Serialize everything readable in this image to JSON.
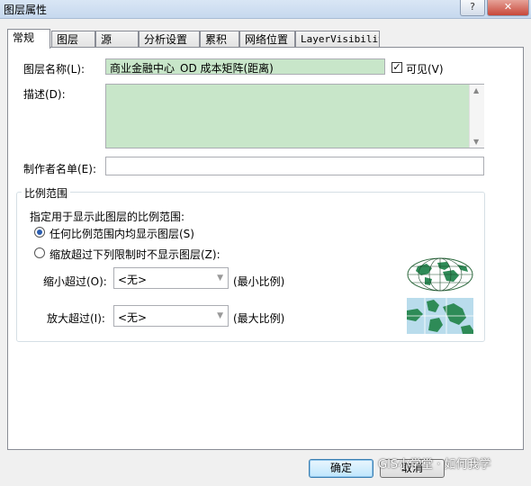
{
  "window": {
    "title": "图层属性",
    "help_label": "?",
    "close_label": "✕"
  },
  "tabs": [
    {
      "label": "常规"
    },
    {
      "label": "图层"
    },
    {
      "label": "源"
    },
    {
      "label": "分析设置"
    },
    {
      "label": "累积"
    },
    {
      "label": "网络位置"
    },
    {
      "label": "LayerVisibility"
    }
  ],
  "general": {
    "layer_name_label": "图层名称(L):",
    "layer_name_value": "商业金融中心_OD 成本矩阵(距离)",
    "visible_label": "可见(V)",
    "visible_checked": true,
    "description_label": "描述(D):",
    "description_value": "",
    "creator_label": "制作者名单(E):",
    "creator_value": ""
  },
  "scale_range": {
    "group_title": "比例范围",
    "instruction": "指定用于显示此图层的比例范围:",
    "option_any": "任何比例范围内均显示图层(S)",
    "option_limit": "缩放超过下列限制时不显示图层(Z):",
    "selected": "any",
    "min_label": "缩小超过(O):",
    "min_value": "<无>",
    "min_hint": "(最小比例)",
    "max_label": "放大超过(I):",
    "max_value": "<无>",
    "max_hint": "(最大比例)"
  },
  "footer": {
    "ok_label": "确定",
    "cancel_label": "取消",
    "watermark": "GIS小学堂 · 如何我学"
  },
  "icons": {
    "globe": "globe-icon",
    "map": "map-icon"
  },
  "colors": {
    "field_green": "#c8e6c9",
    "radio_selected": "#2a5db0",
    "map_land": "#2e8b57",
    "map_water": "#b9dcec"
  }
}
